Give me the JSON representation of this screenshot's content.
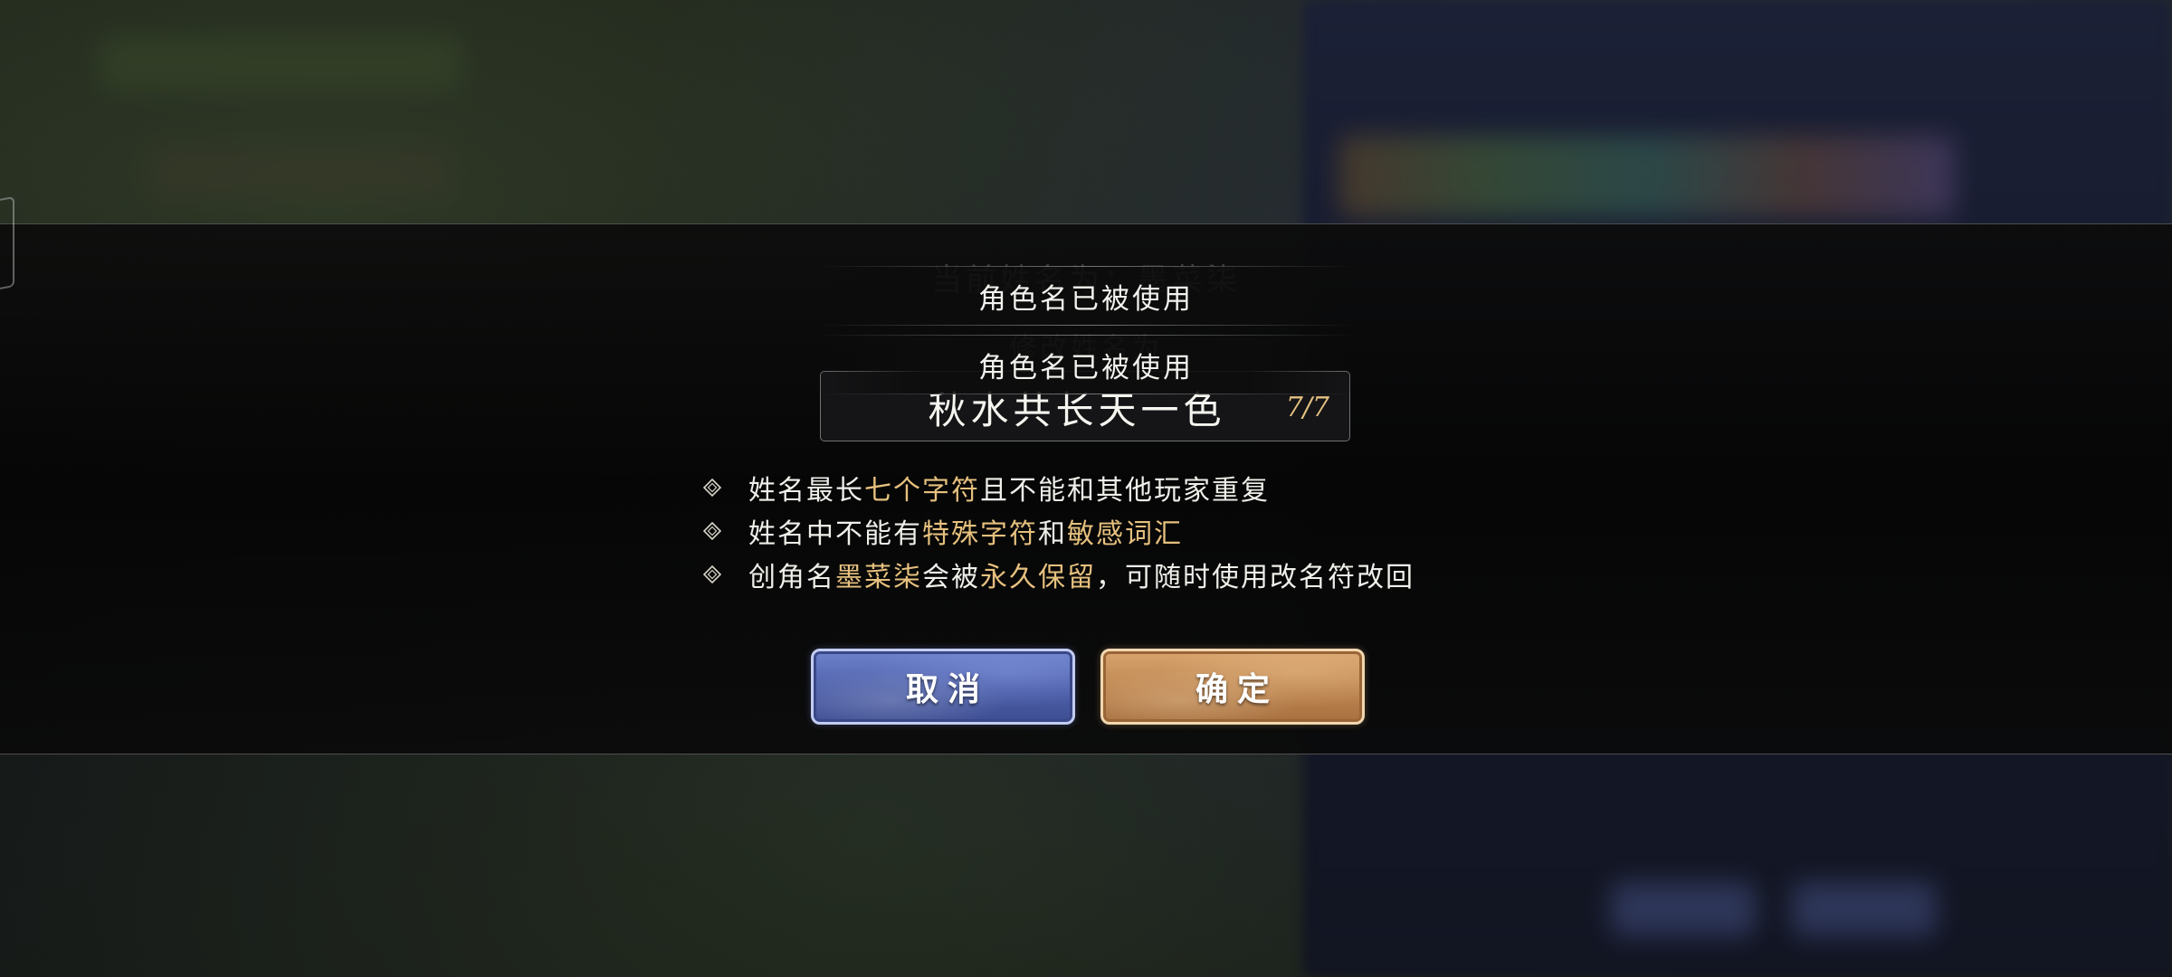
{
  "dialog": {
    "current_name_label": "当前姓名为：墨菜柒",
    "modify_label": "修改姓名为",
    "name_input": {
      "value": "秋水共长天一色",
      "char_count": "7/7"
    },
    "rules": [
      {
        "segments": [
          {
            "text": "姓名最长",
            "highlight": false
          },
          {
            "text": "七个字符",
            "highlight": true
          },
          {
            "text": "且不能和其他玩家重复",
            "highlight": false
          }
        ]
      },
      {
        "segments": [
          {
            "text": "姓名中不能有",
            "highlight": false
          },
          {
            "text": "特殊字符",
            "highlight": true
          },
          {
            "text": "和",
            "highlight": false
          },
          {
            "text": "敏感词汇",
            "highlight": true
          }
        ]
      },
      {
        "segments": [
          {
            "text": "创角名",
            "highlight": false
          },
          {
            "text": "墨菜柒",
            "highlight": true
          },
          {
            "text": "会被",
            "highlight": false
          },
          {
            "text": "永久保留",
            "highlight": true
          },
          {
            "text": "，可随时使用改名符改回",
            "highlight": false
          }
        ]
      }
    ],
    "buttons": {
      "cancel_label": "取消",
      "confirm_label": "确定"
    }
  },
  "toasts": [
    "角色名已被使用",
    "角色名已被使用"
  ],
  "colors": {
    "highlight": "#e6c07e",
    "cancel_button": "#4d5fa8",
    "confirm_button": "#bd8550"
  },
  "icons": {
    "rule_bullet": "diamond-bullet-icon"
  }
}
